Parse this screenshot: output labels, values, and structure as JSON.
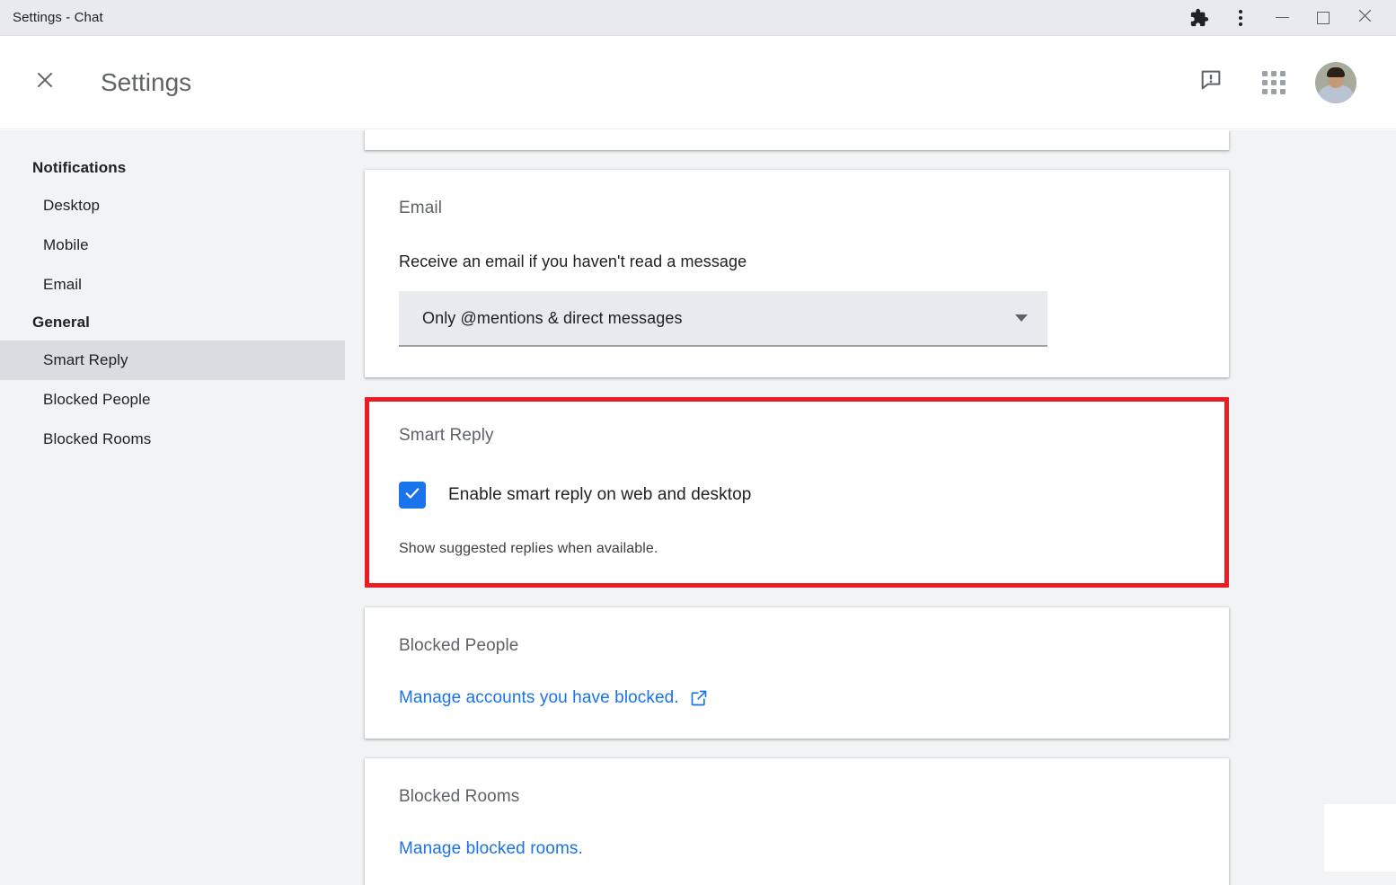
{
  "window": {
    "title": "Settings - Chat",
    "controls": {
      "extensions_icon": "puzzle-piece-icon",
      "menu_icon": "three-dots-vertical-icon",
      "minimize_icon": "minimize-icon",
      "maximize_icon": "maximize-icon",
      "close_icon": "close-icon"
    }
  },
  "appbar": {
    "close_icon": "close-icon",
    "title": "Settings",
    "feedback_icon": "feedback-icon",
    "apps_icon": "apps-grid-icon",
    "avatar_icon": "user-avatar"
  },
  "sidebar": {
    "sections": [
      {
        "label": "Notifications",
        "items": [
          {
            "label": "Desktop",
            "selected": false
          },
          {
            "label": "Mobile",
            "selected": false
          },
          {
            "label": "Email",
            "selected": false
          }
        ]
      },
      {
        "label": "General",
        "items": [
          {
            "label": "Smart Reply",
            "selected": true
          },
          {
            "label": "Blocked People",
            "selected": false
          },
          {
            "label": "Blocked Rooms",
            "selected": false
          }
        ]
      }
    ]
  },
  "main": {
    "email_card": {
      "title": "Email",
      "field_label": "Receive an email if you haven't read a message",
      "select_value": "Only @mentions & direct messages",
      "select_caret_icon": "chevron-down-icon"
    },
    "smart_reply_card": {
      "title": "Smart Reply",
      "checkbox_checked": true,
      "checkbox_icon": "checkmark-icon",
      "checkbox_label": "Enable smart reply on web and desktop",
      "caption": "Show suggested replies when available.",
      "highlight_color": "#eb1c23"
    },
    "blocked_people_card": {
      "title": "Blocked People",
      "link_text": "Manage accounts you have blocked.",
      "link_icon": "external-link-icon"
    },
    "blocked_rooms_card": {
      "title": "Blocked Rooms",
      "link_text": "Manage blocked rooms."
    }
  },
  "colors": {
    "accent_blue": "#1a73e8",
    "highlight_red": "#eb1c23",
    "surface": "#ffffff",
    "background": "#f1f3f4",
    "titlebar": "#e8eaed"
  }
}
